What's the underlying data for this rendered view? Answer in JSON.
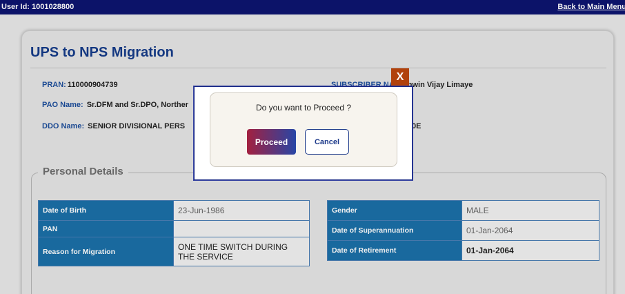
{
  "topbar": {
    "user_id": "User Id: 1001028800",
    "back_link": "Back to Main Menu"
  },
  "page": {
    "title": "UPS to NPS Migration"
  },
  "info": {
    "pran_label": "PRAN:",
    "pran_value": "110000904739",
    "subscriber_label": "SUBSCRIBER NA",
    "subscriber_value": "Ashwin Vijay Limaye",
    "pao_label": "PAO Name:",
    "pao_value": "Sr.DFM and Sr.DPO, Norther",
    "pao_right_value": "l",
    "ddo_label": "DDO Name:",
    "ddo_value": "SENIOR DIVISIONAL PERS",
    "ddo_right_value": "0E"
  },
  "personal_details": {
    "legend": "Personal Details",
    "left": [
      {
        "label": "Date of Birth",
        "value": "23-Jun-1986"
      },
      {
        "label": "PAN",
        "value": ""
      },
      {
        "label": "Reason for Migration",
        "value": "ONE TIME SWITCH DURING THE SERVICE"
      }
    ],
    "right": [
      {
        "label": "Gender",
        "value": "MALE"
      },
      {
        "label": "Date of Superannuation",
        "value": "01-Jan-2064"
      },
      {
        "label": "Date of Retirement",
        "value": "01-Jan-2064"
      }
    ]
  },
  "modal": {
    "close": "X",
    "message": "Do you want to Proceed ?",
    "proceed": "Proceed",
    "cancel": "Cancel"
  }
}
